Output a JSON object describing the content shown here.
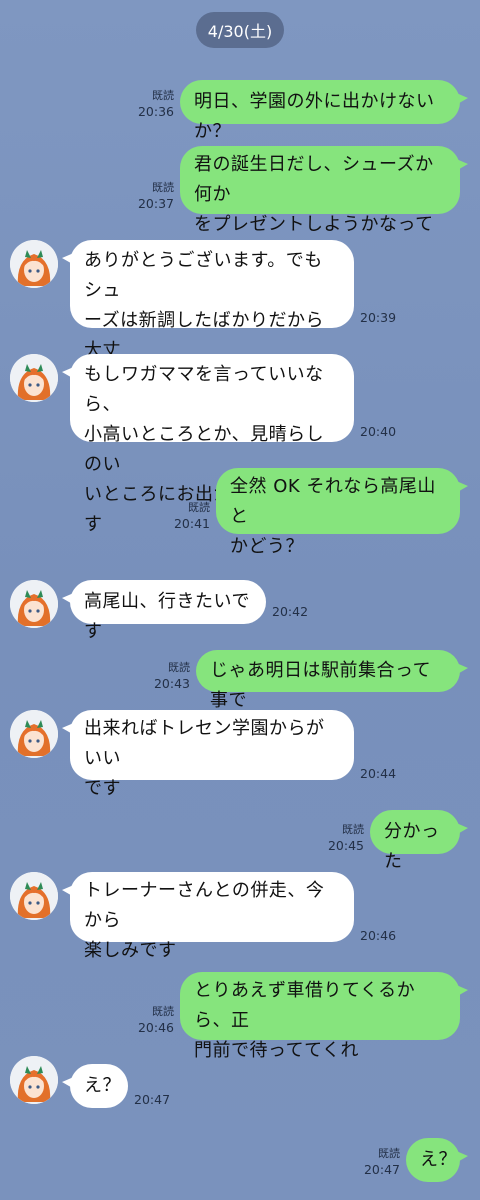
{
  "date_label": "4/30(土)",
  "read_label": "既読",
  "messages": [
    {
      "side": "out",
      "text": "明日、学園の外に出かけないか？",
      "time": "20:36"
    },
    {
      "side": "out",
      "text": "君の誕生日だし、シューズか何か\nをプレゼントしようかなって",
      "time": "20:37"
    },
    {
      "side": "in",
      "text": "ありがとうございます。でもシュ\nーズは新調したばかりだから大丈\n夫です",
      "time": "20:39"
    },
    {
      "side": "in",
      "text": "もしワガママを言っていいなら、\n小高いところとか、見晴らしのい\nいところにお出かけしたいです",
      "time": "20:40"
    },
    {
      "side": "out",
      "text": "全然 OK それなら高尾山と\nかどう？",
      "time": "20:41"
    },
    {
      "side": "in",
      "text": "高尾山、行きたいです",
      "time": "20:42"
    },
    {
      "side": "out",
      "text": "じゃあ明日は駅前集合って事で",
      "time": "20:43"
    },
    {
      "side": "in",
      "text": "出来ればトレセン学園からがいい\nです",
      "time": "20:44"
    },
    {
      "side": "out",
      "text": "分かった",
      "time": "20:45"
    },
    {
      "side": "in",
      "text": "トレーナーさんとの併走、今から\n楽しみです",
      "time": "20:46"
    },
    {
      "side": "out",
      "text": "とりあえず車借りてくるから、正\n門前で待っててくれ",
      "time": "20:46"
    },
    {
      "side": "in",
      "text": "え？",
      "time": "20:47"
    },
    {
      "side": "out",
      "text": "え？",
      "time": "20:47"
    }
  ]
}
